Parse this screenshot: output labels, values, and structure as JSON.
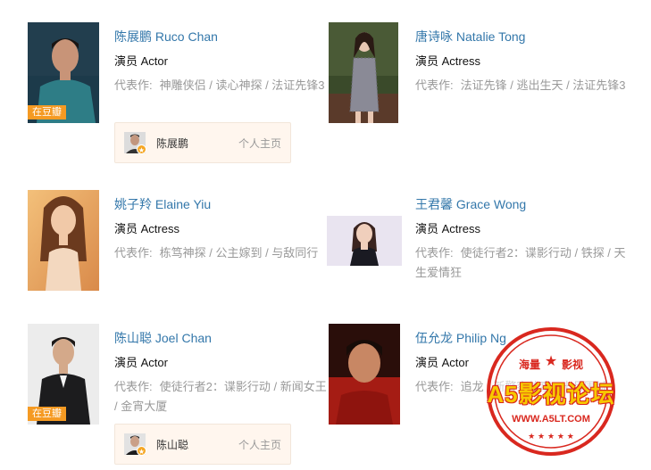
{
  "actors": [
    {
      "name": "陈展鹏 Ruco Chan",
      "role": "演员 Actor",
      "works_label": "代表作:",
      "works": "神雕侠侣 / 读心神探 / 法证先锋3",
      "badge": "在豆瓣",
      "profile": {
        "name": "陈展鹏",
        "link": "个人主页"
      }
    },
    {
      "name": "唐诗咏 Natalie Tong",
      "role": "演员 Actress",
      "works_label": "代表作:",
      "works": "法证先锋 / 逃出生天 / 法证先锋3"
    },
    {
      "name": "姚子羚 Elaine Yiu",
      "role": "演员 Actress",
      "works_label": "代表作:",
      "works": "栋笃神探 / 公主嫁到 / 与敌同行"
    },
    {
      "name": "王君馨 Grace Wong",
      "role": "演员 Actress",
      "works_label": "代表作:",
      "works": "使徒行者2：谍影行动 / 铁探 / 天生爱情狂"
    },
    {
      "name": "陈山聪 Joel Chan",
      "role": "演员 Actor",
      "works_label": "代表作:",
      "works": "使徒行者2：谍影行动 / 新闻女王 / 金宵大厦",
      "badge": "在豆瓣",
      "profile": {
        "name": "陈山聪",
        "link": "个人主页"
      }
    },
    {
      "name": "伍允龙 Philip Ng",
      "role": "演员 Actor",
      "works_label": "代表作:",
      "works": "追龙 / 新警察故事 / 十月围城"
    }
  ],
  "watermark": {
    "top_left": "海量",
    "top_right": "影视",
    "main": "A5影视论坛",
    "url": "WWW.A5LT.COM"
  },
  "colors": {
    "link": "#3377aa",
    "badge": "#f59a23",
    "stamp_red": "#d9281f",
    "stamp_yellow": "#f7c800"
  }
}
